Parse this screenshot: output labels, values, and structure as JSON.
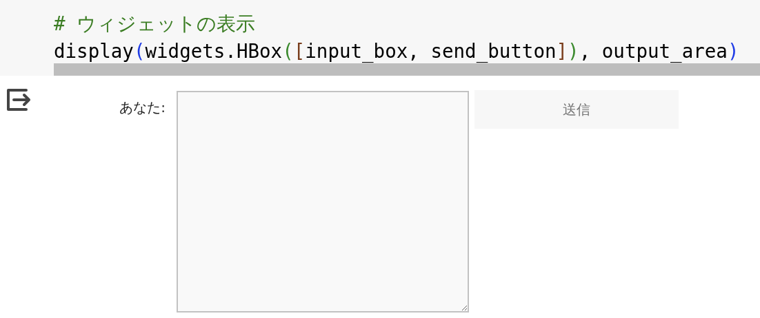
{
  "code_cell": {
    "lines": [
      [
        {
          "text": "# ウィジェットの表示",
          "color": "#3b7d23"
        }
      ],
      [
        {
          "text": "display",
          "color": "#000000"
        },
        {
          "text": "(",
          "color": "#1f3ce6"
        },
        {
          "text": "widgets.HBox",
          "color": "#000000"
        },
        {
          "text": "(",
          "color": "#3b8a2e"
        },
        {
          "text": "[",
          "color": "#7a3e1d"
        },
        {
          "text": "input_box, send_button",
          "color": "#000000"
        },
        {
          "text": "]",
          "color": "#7a3e1d"
        },
        {
          "text": ")",
          "color": "#3b8a2e"
        },
        {
          "text": ", output_area",
          "color": "#000000"
        },
        {
          "text": ")",
          "color": "#1f3ce6"
        }
      ]
    ]
  },
  "output": {
    "input_label": "あなた:",
    "send_button": "送信"
  }
}
